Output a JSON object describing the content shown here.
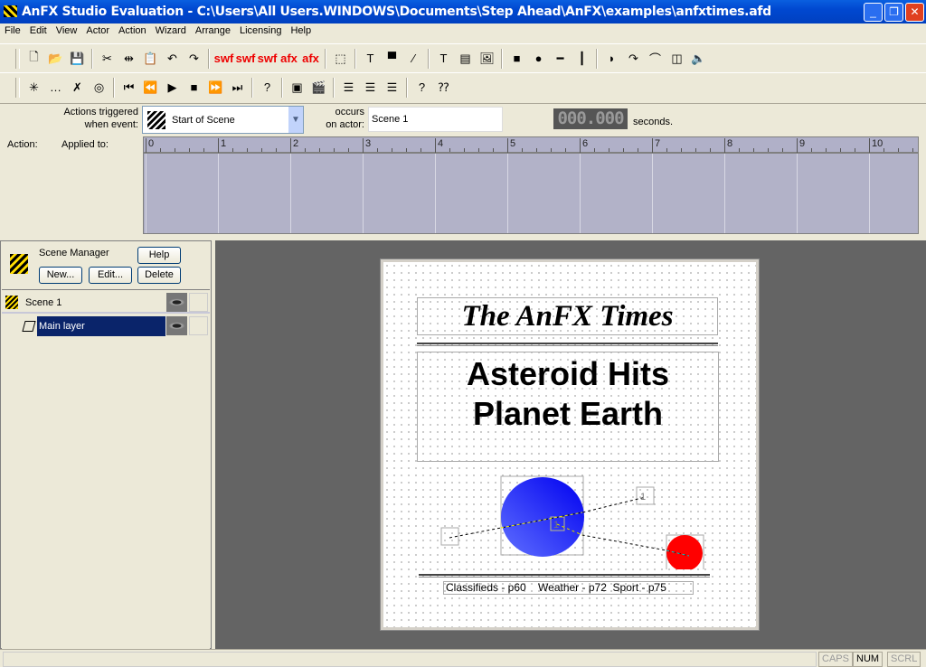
{
  "window": {
    "title": "AnFX Studio Evaluation - C:\\Users\\All Users.WINDOWS\\Documents\\Step Ahead\\AnFX\\examples\\anfxtimes.afd",
    "minimize": "_",
    "maximize": "❐",
    "close": "✕"
  },
  "menu": [
    "File",
    "Edit",
    "View",
    "Actor",
    "Action",
    "Wizard",
    "Arrange",
    "Licensing",
    "Help"
  ],
  "toolbar1": [
    {
      "icon": "new-icon",
      "g": "🗋"
    },
    {
      "icon": "open-icon",
      "g": "📂"
    },
    {
      "icon": "save-icon",
      "g": "💾"
    },
    "sep",
    {
      "icon": "cut-icon",
      "g": "✂"
    },
    {
      "icon": "mirror-icon",
      "g": "⇹"
    },
    {
      "icon": "paste-icon",
      "g": "📋"
    },
    {
      "icon": "undo-icon",
      "g": "↶"
    },
    {
      "icon": "redo-icon",
      "g": "↷"
    },
    "sep",
    {
      "icon": "export-swf-icon",
      "t": "swf"
    },
    {
      "icon": "export-swf2-icon",
      "t": "swf"
    },
    {
      "icon": "export-swf3-icon",
      "t": "swf"
    },
    {
      "icon": "export-afx-icon",
      "t": "afx"
    },
    {
      "icon": "export-afx2-icon",
      "t": "afx"
    },
    "sep",
    {
      "icon": "resize-icon",
      "g": "⬚"
    },
    "sep",
    {
      "icon": "text-tool-icon",
      "g": "T"
    },
    {
      "icon": "callout-icon",
      "g": "▀"
    },
    {
      "icon": "line-callout-icon",
      "g": "⁄"
    },
    "sep",
    {
      "icon": "text-icon",
      "g": "T"
    },
    {
      "icon": "list-icon",
      "g": "▤"
    },
    {
      "icon": "picture-icon",
      "g": "🖼"
    },
    "sep",
    {
      "icon": "rectangle-icon",
      "g": "■"
    },
    {
      "icon": "circle-icon",
      "g": "●"
    },
    {
      "icon": "hline-icon",
      "g": "━"
    },
    {
      "icon": "vline-icon",
      "g": "┃"
    },
    "sep",
    {
      "icon": "shape-icon",
      "g": "◗"
    },
    {
      "icon": "path-icon",
      "g": "↷"
    },
    {
      "icon": "bezier-icon",
      "g": "⌒"
    },
    {
      "icon": "layers-icon",
      "g": "◫"
    },
    {
      "icon": "sound-icon",
      "g": "🔈"
    }
  ],
  "toolbar2": [
    {
      "icon": "new-action-icon",
      "g": "✳"
    },
    {
      "icon": "action-list-icon",
      "g": "…"
    },
    {
      "icon": "delete-action-icon",
      "g": "✗"
    },
    {
      "icon": "target-icon",
      "g": "◎"
    },
    "sep",
    {
      "icon": "first-icon",
      "g": "⏮"
    },
    {
      "icon": "rewind-icon",
      "g": "⏪"
    },
    {
      "icon": "play-icon",
      "g": "▶"
    },
    {
      "icon": "stop-icon",
      "g": "■"
    },
    {
      "icon": "fast-forward-icon",
      "g": "⏩"
    },
    {
      "icon": "last-icon",
      "g": "⏭"
    },
    "sep",
    {
      "icon": "check-action-icon",
      "g": "?"
    },
    "sep",
    {
      "icon": "film-icon",
      "g": "▣"
    },
    {
      "icon": "clapper-icon",
      "g": "🎬"
    },
    "sep",
    {
      "icon": "align-left-icon",
      "g": "☰"
    },
    {
      "icon": "align-center-icon",
      "g": "☰"
    },
    {
      "icon": "align-right-icon",
      "g": "☰"
    },
    "sep",
    {
      "icon": "help-icon",
      "g": "?"
    },
    {
      "icon": "context-help-icon",
      "g": "⁇"
    }
  ],
  "event": {
    "triggered_label_1": "Actions triggered",
    "triggered_label_2": "when event:",
    "event_value": "Start of Scene",
    "occurs_1": "occurs",
    "occurs_2": "on actor:",
    "actor_value": "Scene 1",
    "time": "000.000",
    "seconds": "seconds.",
    "action_label": "Action:",
    "applied_label": "Applied to:"
  },
  "timeline": {
    "ticks": [
      "0",
      "1",
      "2",
      "3",
      "4",
      "5",
      "6",
      "7",
      "8",
      "9",
      "10"
    ]
  },
  "scene_manager": {
    "title": "Scene Manager",
    "help": "Help",
    "new": "New...",
    "edit": "Edit...",
    "delete": "Delete",
    "items": [
      {
        "label": "Scene 1",
        "selected": false
      },
      {
        "label": "Main layer",
        "selected": true
      }
    ]
  },
  "canvas": {
    "masthead": "The AnFX Times",
    "headline_1": "Asteroid Hits",
    "headline_2": "Planet Earth",
    "marker_1": "1",
    "marker_2": "1",
    "footer": "Classifieds - p60    Weather - p72  Sport - p75"
  },
  "status": {
    "caps": "CAPS",
    "num": "NUM",
    "scrl": "SCRL"
  },
  "colors": {
    "title_bar": "#0048d0",
    "selection": "#0a246a",
    "asteroid": "#2020f0",
    "earth": "#ff0000",
    "workspace": "#646464"
  }
}
